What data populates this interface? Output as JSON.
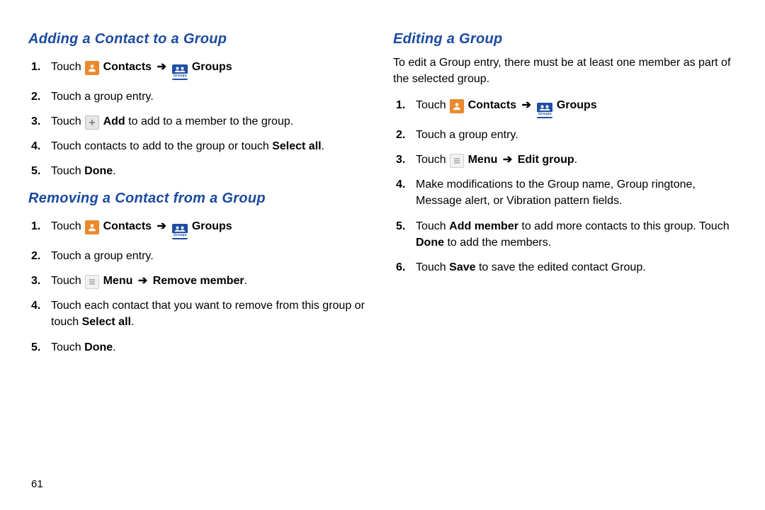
{
  "page_number": "61",
  "arrow": "➔",
  "icons": {
    "contact_label": "Contacts",
    "groups_label": "Groups",
    "groups_mini": "Groups",
    "add_label": "Add",
    "menu_label": "Menu"
  },
  "left": {
    "section1": {
      "heading": "Adding a Contact to a Group",
      "steps": {
        "s1": {
          "pre": "Touch ",
          "contacts_b": "Contacts",
          "groups_b": "Groups"
        },
        "s2": "Touch a group entry.",
        "s3": {
          "pre": "Touch ",
          "add_b": "Add",
          "post": " to add to a member to the group."
        },
        "s4": {
          "pre": "Touch contacts to add to the group or touch ",
          "b": "Select all",
          "post": "."
        },
        "s5": {
          "pre": "Touch ",
          "b": "Done",
          "post": "."
        }
      }
    },
    "section2": {
      "heading": "Removing a Contact from a Group",
      "steps": {
        "s1": {
          "pre": "Touch ",
          "contacts_b": "Contacts",
          "groups_b": "Groups"
        },
        "s2": "Touch a group entry.",
        "s3": {
          "pre": "Touch ",
          "menu_b": "Menu",
          "action_b": "Remove member",
          "post": "."
        },
        "s4": {
          "pre": "Touch each contact that you want to remove from this group or touch ",
          "b": "Select all",
          "post": "."
        },
        "s5": {
          "pre": "Touch ",
          "b": "Done",
          "post": "."
        }
      }
    }
  },
  "right": {
    "section1": {
      "heading": "Editing a Group",
      "intro": "To edit a Group entry, there must be at least one member as part of the selected group.",
      "steps": {
        "s1": {
          "pre": "Touch ",
          "contacts_b": "Contacts",
          "groups_b": "Groups"
        },
        "s2": "Touch a group entry.",
        "s3": {
          "pre": "Touch ",
          "menu_b": "Menu",
          "action_b": "Edit group",
          "post": "."
        },
        "s4": "Make modifications to the Group name, Group ringtone, Message alert, or Vibration pattern fields.",
        "s5": {
          "pre": "Touch ",
          "b1": "Add member",
          "mid": " to add more contacts to this group. Touch ",
          "b2": "Done",
          "post": " to add the members."
        },
        "s6": {
          "pre": "Touch ",
          "b": "Save",
          "post": " to save the edited contact Group."
        }
      }
    }
  }
}
